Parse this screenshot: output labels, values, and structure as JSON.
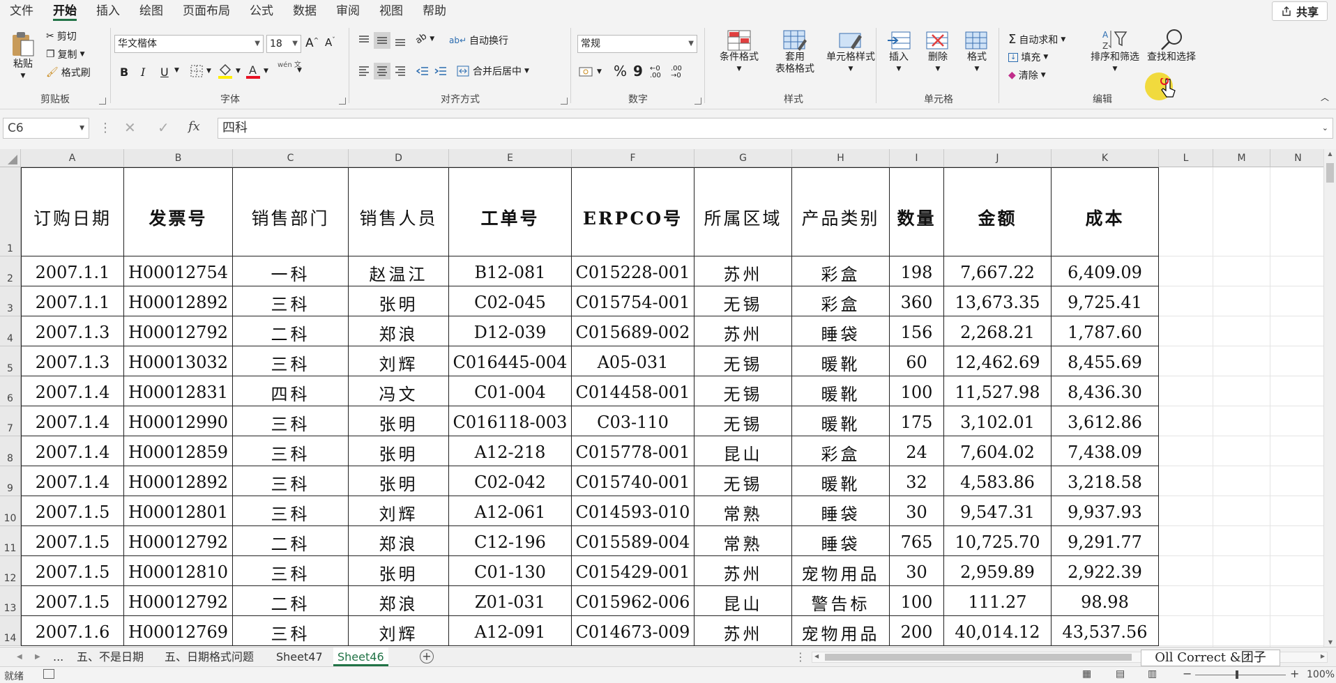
{
  "menu": {
    "tabs": [
      "文件",
      "开始",
      "插入",
      "绘图",
      "页面布局",
      "公式",
      "数据",
      "审阅",
      "视图",
      "帮助"
    ],
    "share": "共享"
  },
  "ribbon": {
    "clipboard": {
      "paste": "粘贴",
      "cut": "剪切",
      "copy": "复制",
      "painter": "格式刷",
      "label": "剪贴板"
    },
    "font": {
      "name": "华文楷体",
      "size": "18",
      "bold": "B",
      "italic": "I",
      "underline": "U",
      "wen": "wén 文",
      "label": "字体"
    },
    "align": {
      "wrap": "自动换行",
      "merge": "合并后居中",
      "label": "对齐方式"
    },
    "number": {
      "format": "常规",
      "percent": "%",
      "comma": "9",
      "label": "数字"
    },
    "styles": {
      "cond": "条件格式",
      "table": "套用\n表格格式",
      "cell": "单元格样式",
      "label": "样式"
    },
    "cells": {
      "insert": "插入",
      "delete": "删除",
      "format": "格式",
      "label": "单元格"
    },
    "editing": {
      "autosum": "自动求和",
      "fill": "填充",
      "clear": "清除",
      "sort": "排序和筛选",
      "find": "查找和选择",
      "label": "编辑"
    },
    "colors": {
      "accent": "#217346",
      "highlight": "#ffee00",
      "fontcolor": "#e81123"
    }
  },
  "formula": {
    "name": "C6",
    "value": "四科",
    "fx": "fx"
  },
  "grid": {
    "columns": [
      "A",
      "B",
      "C",
      "D",
      "E",
      "F",
      "G",
      "H",
      "I",
      "J",
      "K",
      "L",
      "M",
      "N"
    ],
    "headers": [
      "订购日期",
      "发票号",
      "销售部门",
      "销售人员",
      "工单号",
      "ERPCO号",
      "所属区域",
      "产品类别",
      "数量",
      "金额",
      "成本"
    ],
    "rows": [
      [
        "2007.1.1",
        "H00012754",
        "一科",
        "赵温江",
        "B12-081",
        "C015228-001",
        "苏州",
        "彩盒",
        "198",
        "7,667.22",
        "6,409.09"
      ],
      [
        "2007.1.1",
        "H00012892",
        "三科",
        "张明",
        "C02-045",
        "C015754-001",
        "无锡",
        "彩盒",
        "360",
        "13,673.35",
        "9,725.41"
      ],
      [
        "2007.1.3",
        "H00012792",
        "二科",
        "郑浪",
        "D12-039",
        "C015689-002",
        "苏州",
        "睡袋",
        "156",
        "2,268.21",
        "1,787.60"
      ],
      [
        "2007.1.3",
        "H00013032",
        "三科",
        "刘辉",
        "C016445-004",
        "A05-031",
        "无锡",
        "暖靴",
        "60",
        "12,462.69",
        "8,455.69"
      ],
      [
        "2007.1.4",
        "H00012831",
        "四科",
        "冯文",
        "C01-004",
        "C014458-001",
        "无锡",
        "暖靴",
        "100",
        "11,527.98",
        "8,436.30"
      ],
      [
        "2007.1.4",
        "H00012990",
        "三科",
        "张明",
        "C016118-003",
        "C03-110",
        "无锡",
        "暖靴",
        "175",
        "3,102.01",
        "3,612.86"
      ],
      [
        "2007.1.4",
        "H00012859",
        "三科",
        "张明",
        "A12-218",
        "C015778-001",
        "昆山",
        "彩盒",
        "24",
        "7,604.02",
        "7,438.09"
      ],
      [
        "2007.1.4",
        "H00012892",
        "三科",
        "张明",
        "C02-042",
        "C015740-001",
        "无锡",
        "暖靴",
        "32",
        "4,583.86",
        "3,218.58"
      ],
      [
        "2007.1.5",
        "H00012801",
        "三科",
        "刘辉",
        "A12-061",
        "C014593-010",
        "常熟",
        "睡袋",
        "30",
        "9,547.31",
        "9,937.93"
      ],
      [
        "2007.1.5",
        "H00012792",
        "二科",
        "郑浪",
        "C12-196",
        "C015589-004",
        "常熟",
        "睡袋",
        "765",
        "10,725.70",
        "9,291.77"
      ],
      [
        "2007.1.5",
        "H00012810",
        "三科",
        "张明",
        "C01-130",
        "C015429-001",
        "苏州",
        "宠物用品",
        "30",
        "2,959.89",
        "2,922.39"
      ],
      [
        "2007.1.5",
        "H00012792",
        "二科",
        "郑浪",
        "Z01-031",
        "C015962-006",
        "昆山",
        "警告标",
        "100",
        "111.27",
        "98.98"
      ],
      [
        "2007.1.6",
        "H00012769",
        "三科",
        "刘辉",
        "A12-091",
        "C014673-009",
        "苏州",
        "宠物用品",
        "200",
        "40,014.12",
        "43,537.56"
      ]
    ]
  },
  "sheets": {
    "more": "...",
    "tabs": [
      "五、不是日期",
      "五、日期格式问题",
      "Sheet47",
      "Sheet46"
    ],
    "active": 3
  },
  "status": {
    "ready": "就绪",
    "zoom": "100%"
  },
  "watermark": "Oll Correct &团子"
}
